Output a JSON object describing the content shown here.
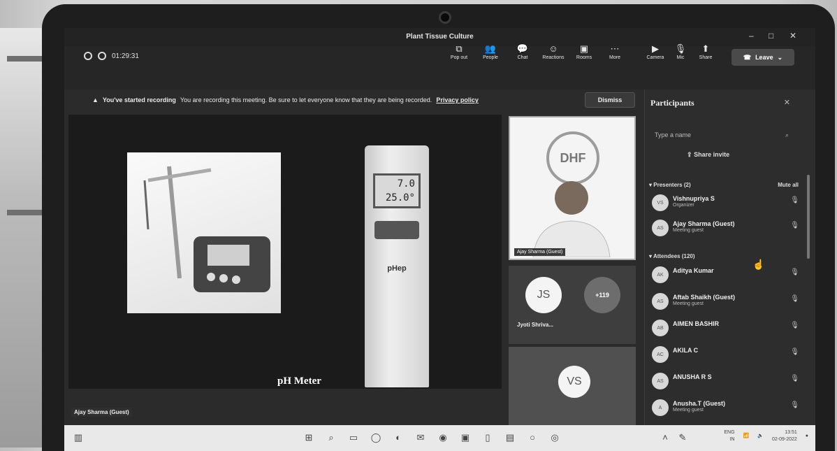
{
  "window": {
    "title": "Plant Tissue Culture",
    "minimize": "–",
    "maximize": "□",
    "close": "✕"
  },
  "meeting": {
    "timer": "01:29:31"
  },
  "toolbar": {
    "items": [
      {
        "label": "Pop out",
        "icon": "popout-icon",
        "glyph": "⧉"
      },
      {
        "label": "People",
        "icon": "people-icon",
        "glyph": "👥"
      },
      {
        "label": "Chat",
        "icon": "chat-icon",
        "glyph": "💬"
      },
      {
        "label": "Reactions",
        "icon": "reactions-icon",
        "glyph": "☺"
      },
      {
        "label": "Rooms",
        "icon": "rooms-icon",
        "glyph": "▣"
      },
      {
        "label": "More",
        "icon": "more-icon",
        "glyph": "⋯"
      },
      {
        "label": "Camera",
        "icon": "camera-icon",
        "glyph": "▶"
      },
      {
        "label": "Mic",
        "icon": "mic-icon",
        "glyph": "🎙"
      },
      {
        "label": "Share",
        "icon": "share-icon",
        "glyph": "⬆"
      }
    ],
    "leave_label": "Leave"
  },
  "banner": {
    "heading": "You've started recording",
    "message": "You are recording this meeting. Be sure to let everyone know that they are being recorded.",
    "link": "Privacy policy",
    "dismiss": "Dismiss"
  },
  "presentation": {
    "lcd_line1": "7.0",
    "lcd_line2": "25.0°",
    "device_label": "pHep",
    "caption": "pH Meter",
    "presenter_tag": "Ajay Sharma (Guest)"
  },
  "videos": {
    "main_label": "Ajay Sharma (Guest)",
    "main_logo": "DHF",
    "tile_js_initials": "JS",
    "tile_js_name": "Jyoti Shriva...",
    "overflow": "+119",
    "tile_vs_initials": "VS"
  },
  "participants": {
    "title": "Participants",
    "search_placeholder": "Type a name",
    "share_invite": "Share invite",
    "presenters_header": "Presenters (2)",
    "mute_all": "Mute all",
    "attendees_header": "Attendees (120)",
    "presenters": [
      {
        "initials": "VS",
        "name": "Vishnupriya S",
        "role": "Organizer"
      },
      {
        "initials": "AS",
        "name": "Ajay Sharma (Guest)",
        "role": "Meeting guest"
      }
    ],
    "attendees": [
      {
        "initials": "AK",
        "name": "Aditya Kumar",
        "role": ""
      },
      {
        "initials": "AS",
        "name": "Aftab Shaikh (Guest)",
        "role": "Meeting guest"
      },
      {
        "initials": "AB",
        "name": "AIMEN BASHIR",
        "role": ""
      },
      {
        "initials": "AC",
        "name": "AKILA C",
        "role": ""
      },
      {
        "initials": "AS",
        "name": "ANUSHA R S",
        "role": ""
      },
      {
        "initials": "A",
        "name": "Anusha.T (Guest)",
        "role": "Meeting guest"
      }
    ]
  },
  "taskbar": {
    "lang": "ENG",
    "region": "IN",
    "time": "13:51",
    "date": "02-09-2022"
  }
}
